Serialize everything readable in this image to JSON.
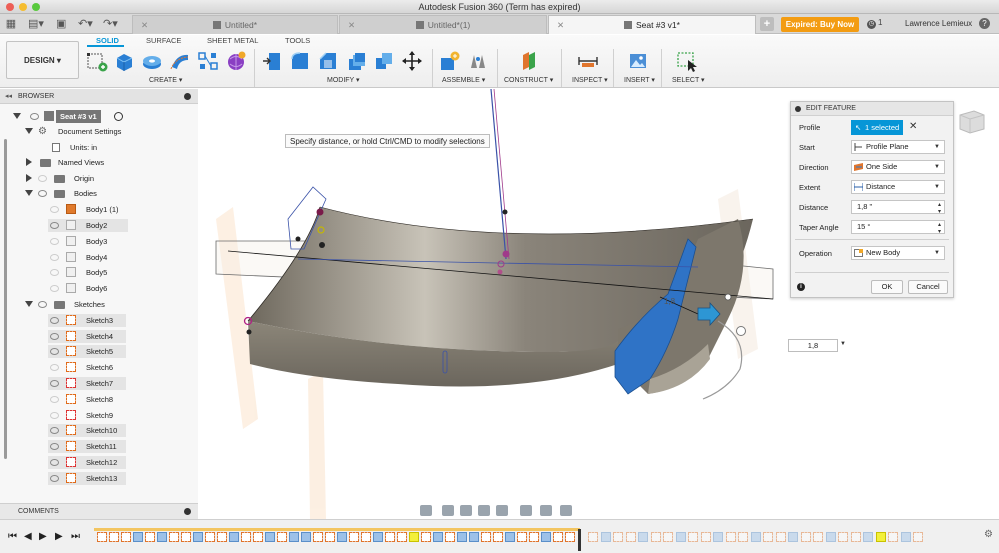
{
  "window": {
    "title": "Autodesk Fusion 360 (Term has expired)"
  },
  "tabs": [
    {
      "label": "Untitled*"
    },
    {
      "label": "Untitled*(1)"
    },
    {
      "label": "Seat #3 v1*"
    }
  ],
  "header": {
    "expired_button": "Expired: Buy Now",
    "jobs_count": "1",
    "user_name": "Lawrence Lemieux",
    "help_icon": "?"
  },
  "ribbon": {
    "workspace": "DESIGN",
    "tabs": [
      "SOLID",
      "SURFACE",
      "SHEET METAL",
      "TOOLS"
    ],
    "groups": [
      "CREATE",
      "MODIFY",
      "ASSEMBLE",
      "CONSTRUCT",
      "INSPECT",
      "INSERT",
      "SELECT"
    ]
  },
  "browser": {
    "title": "BROWSER",
    "root": "Seat #3 v1",
    "document_settings": "Document Settings",
    "units": "Units: in",
    "named_views": "Named Views",
    "origin": "Origin",
    "bodies_label": "Bodies",
    "bodies": [
      "Body1 (1)",
      "Body2",
      "Body3",
      "Body4",
      "Body5",
      "Body6"
    ],
    "sketches_label": "Sketches",
    "sketches": [
      "Sketch3",
      "Sketch4",
      "Sketch5",
      "Sketch6",
      "Sketch7",
      "Sketch8",
      "Sketch9",
      "Sketch10",
      "Sketch11",
      "Sketch12",
      "Sketch13"
    ]
  },
  "comments": {
    "label": "COMMENTS"
  },
  "viewport": {
    "tooltip": "Specify distance, or hold Ctrl/CMD to modify selections",
    "distance_input": "1,8",
    "dimension_label": "1,8"
  },
  "edit_feature": {
    "title": "EDIT FEATURE",
    "rows": {
      "profile": {
        "label": "Profile",
        "value": "1 selected"
      },
      "start": {
        "label": "Start",
        "value": "Profile Plane"
      },
      "direction": {
        "label": "Direction",
        "value": "One Side"
      },
      "extent": {
        "label": "Extent",
        "value": "Distance"
      },
      "distance": {
        "label": "Distance",
        "value": "1,8 \""
      },
      "taper": {
        "label": "Taper Angle",
        "value": "15 °"
      },
      "operation": {
        "label": "Operation",
        "value": "New Body"
      }
    },
    "ok": "OK",
    "cancel": "Cancel"
  },
  "colors": {
    "accent": "#0696d7",
    "expired": "#f39c12",
    "surface": "#7a7469",
    "blue_face": "#2f73c6",
    "sketch": "#e0752d"
  }
}
